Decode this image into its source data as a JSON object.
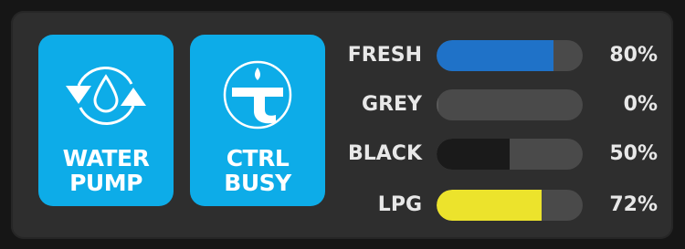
{
  "colors": {
    "tile_bg": "#0dace8",
    "fresh": "#1f72c8",
    "grey": "#4a4a4a",
    "black": "#1a1a1a",
    "lpg": "#ece32c",
    "track": "#4a4a4a",
    "panel": "#2e2e2e"
  },
  "buttons": [
    {
      "id": "water-pump",
      "icon": "water-pump-icon",
      "line1": "WATER",
      "line2": "PUMP"
    },
    {
      "id": "ctrl-busy",
      "icon": "truma-logo-icon",
      "line1": "CTRL",
      "line2": "BUSY"
    }
  ],
  "tanks": [
    {
      "name": "FRESH",
      "level": 0.8,
      "percent_label": "80%",
      "color": "#1f72c8"
    },
    {
      "name": "GREY",
      "level": 0.0,
      "percent_label": "0%",
      "color": "#5a5a5a"
    },
    {
      "name": "BLACK",
      "level": 0.5,
      "percent_label": "50%",
      "color": "#1a1a1a"
    },
    {
      "name": "LPG",
      "level": 0.72,
      "percent_label": "72%",
      "color": "#ece32c"
    }
  ]
}
